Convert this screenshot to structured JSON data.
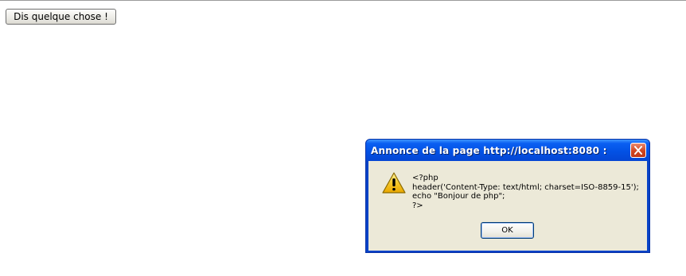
{
  "page": {
    "button_label": "Dis quelque chose !"
  },
  "dialog": {
    "title": "Annonce de la page  http://localhost:8080  :",
    "icon": "warning-icon",
    "close_icon": "close-icon",
    "message_lines": [
      "<?php",
      "header('Content-Type: text/html; charset=ISO-8859-15');",
      "echo \"Bonjour de php\";",
      "?>"
    ],
    "ok_label": "OK"
  },
  "colors": {
    "titlebar": "#0352e5",
    "close_button": "#d1451f",
    "dialog_background": "#ece9d8",
    "warning_fill": "#f7c82b"
  }
}
